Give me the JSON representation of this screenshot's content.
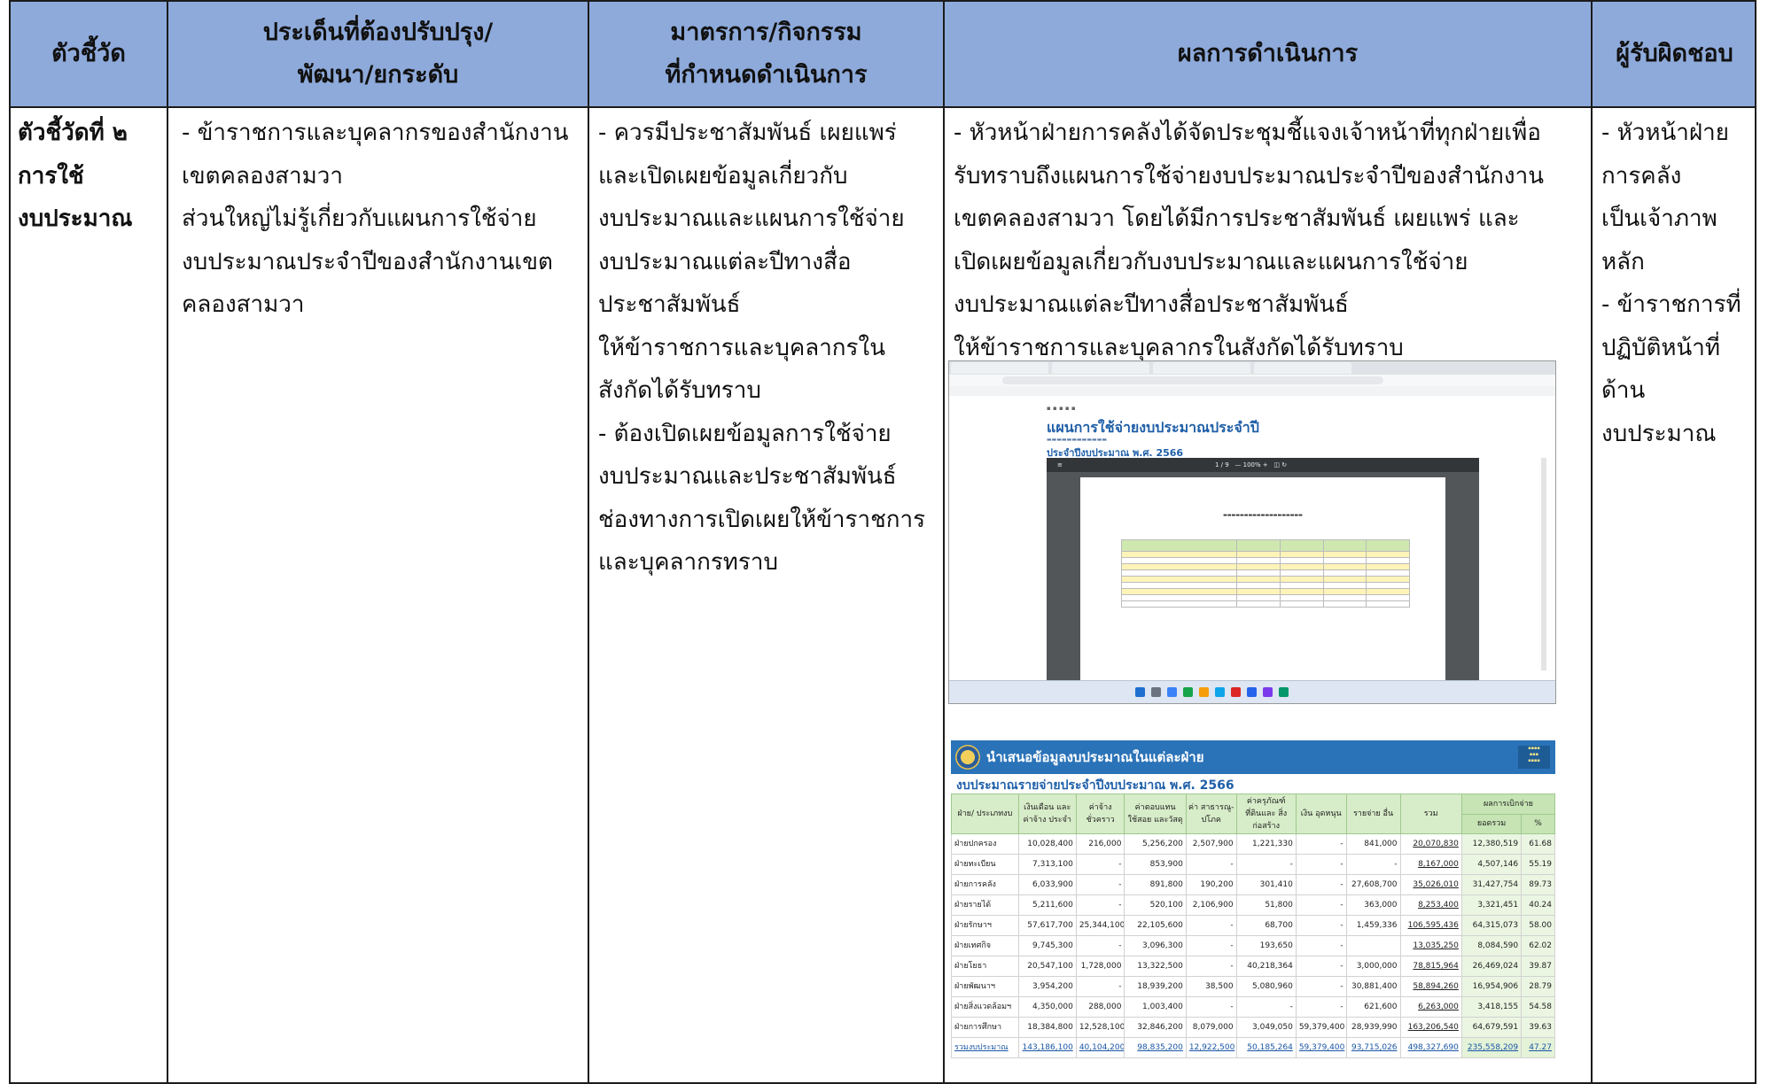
{
  "headers": {
    "indicator": "ตัวชี้วัด",
    "issue_l1": "ประเด็นที่ต้องปรับปรุง/",
    "issue_l2": "พัฒนา/ยกระดับ",
    "measure_l1": "มาตรการ/กิจกรรม",
    "measure_l2": "ที่กำหนดดำเนินการ",
    "result": "ผลการดำเนินการ",
    "owner": "ผู้รับผิดชอบ"
  },
  "indicator_lines": [
    "ตัวชี้วัดที่ ๒",
    "การใช้",
    "งบประมาณ"
  ],
  "issue_lines": [
    "- ข้าราชการและบุคลากรของสำนักงาน",
    "เขตคลองสามวา",
    "ส่วนใหญ่ไม่รู้เกี่ยวกับแผนการใช้จ่าย",
    "งบประมาณประจำปีของสำนักงานเขต",
    "คลองสามวา"
  ],
  "measure_lines": [
    "- ควรมีประชาสัมพันธ์ เผยแพร่",
    "และเปิดเผยข้อมูลเกี่ยวกับ",
    "งบประมาณและแผนการใช้จ่าย",
    "งบประมาณแต่ละปีทางสื่อ",
    "ประชาสัมพันธ์",
    "ให้ข้าราชการและบุคลากรใน",
    "สังกัดได้รับทราบ",
    "- ต้องเปิดเผยข้อมูลการใช้จ่าย",
    "งบประมาณและประชาสัมพันธ์",
    "ช่องทางการเปิดเผยให้ข้าราชการ",
    "และบุคลากรทราบ"
  ],
  "result_lines": [
    "- หัวหน้าฝ่ายการคลังได้จัดประชุมชี้แจงเจ้าหน้าที่ทุกฝ่ายเพื่อ",
    "รับทราบถึงแผนการใช้จ่ายงบประมาณประจำปีของสำนักงาน",
    "เขตคลองสามวา โดยได้มีการประชาสัมพันธ์ เผยแพร่ และ",
    "เปิดเผยข้อมูลเกี่ยวกับงบประมาณและแผนการใช้จ่าย",
    "งบประมาณแต่ละปีทางสื่อประชาสัมพันธ์",
    "ให้ข้าราชการและบุคลากรในสังกัดได้รับทราบ"
  ],
  "owner_lines": [
    "- หัวหน้าฝ่าย",
    "การคลัง",
    "เป็นเจ้าภาพ",
    "หลัก",
    "- ข้าราชการที่",
    "ปฏิบัติหน้าที่",
    "ด้าน",
    "งบประมาณ"
  ],
  "screenshot_plan": {
    "title": "แผนการใช้จ่ายงบประมาณประจำปี",
    "year": "ประจำปีงบประมาณ พ.ศ. 2566"
  },
  "budget": {
    "banner_title": "นำเสนอข้อมูลงบประมาณในแต่ละฝ่าย",
    "subtitle": "งบประมาณรายจ่ายประจำปีงบประมาณ พ.ศ. 2566",
    "columns": [
      "ฝ่าย/ ประเภทงบ",
      "เงินเดือน และค่าจ้าง ประจำ",
      "ค่าจ้าง ชั่วคราว",
      "ค่าตอบแทน ใช้สอย และวัสดุ",
      "ค่า สาธารณู- ปโภค",
      "ค่าครุภัณฑ์ ที่ดินและ สิ่งก่อสร้าง",
      "เงิน อุดหนุน",
      "รายจ่าย อื่น",
      "รวม"
    ],
    "result_group": "ผลการเบิกจ่าย",
    "result_cols": [
      "ยอดรวม",
      "%"
    ],
    "rows": [
      [
        "ฝ่ายปกครอง",
        "10,028,400",
        "216,000",
        "5,256,200",
        "2,507,900",
        "1,221,330",
        "-",
        "841,000",
        "20,070,830",
        "12,380,519",
        "61.68"
      ],
      [
        "ฝ่ายทะเบียน",
        "7,313,100",
        "-",
        "853,900",
        "-",
        "-",
        "-",
        "-",
        "8,167,000",
        "4,507,146",
        "55.19"
      ],
      [
        "ฝ่ายการคลัง",
        "6,033,900",
        "-",
        "891,800",
        "190,200",
        "301,410",
        "-",
        "27,608,700",
        "35,026,010",
        "31,427,754",
        "89.73"
      ],
      [
        "ฝ่ายรายได้",
        "5,211,600",
        "-",
        "520,100",
        "2,106,900",
        "51,800",
        "-",
        "363,000",
        "8,253,400",
        "3,321,451",
        "40.24"
      ],
      [
        "ฝ่ายรักษาฯ",
        "57,617,700",
        "25,344,100",
        "22,105,600",
        "-",
        "68,700",
        "-",
        "1,459,336",
        "106,595,436",
        "64,315,073",
        "58.00"
      ],
      [
        "ฝ่ายเทศกิจ",
        "9,745,300",
        "-",
        "3,096,300",
        "-",
        "193,650",
        "-",
        "",
        "13,035,250",
        "8,084,590",
        "62.02"
      ],
      [
        "ฝ่ายโยธา",
        "20,547,100",
        "1,728,000",
        "13,322,500",
        "-",
        "40,218,364",
        "-",
        "3,000,000",
        "78,815,964",
        "26,469,024",
        "39.87"
      ],
      [
        "ฝ่ายพัฒนาฯ",
        "3,954,200",
        "-",
        "18,939,200",
        "38,500",
        "5,080,960",
        "-",
        "30,881,400",
        "58,894,260",
        "16,954,906",
        "28.79"
      ],
      [
        "ฝ่ายสิ่งแวดล้อมฯ",
        "4,350,000",
        "288,000",
        "1,003,400",
        "-",
        "-",
        "-",
        "621,600",
        "6,263,000",
        "3,418,155",
        "54.58"
      ],
      [
        "ฝ่ายการศึกษา",
        "18,384,800",
        "12,528,100",
        "32,846,200",
        "8,079,000",
        "3,049,050",
        "59,379,400",
        "28,939,990",
        "163,206,540",
        "64,679,591",
        "39.63"
      ]
    ],
    "total": [
      "รวมงบประมาณ",
      "143,186,100",
      "40,104,200",
      "98,835,200",
      "12,922,500",
      "50,185,264",
      "59,379,400",
      "93,715,026",
      "498,327,690",
      "235,558,209",
      "47.27"
    ]
  }
}
